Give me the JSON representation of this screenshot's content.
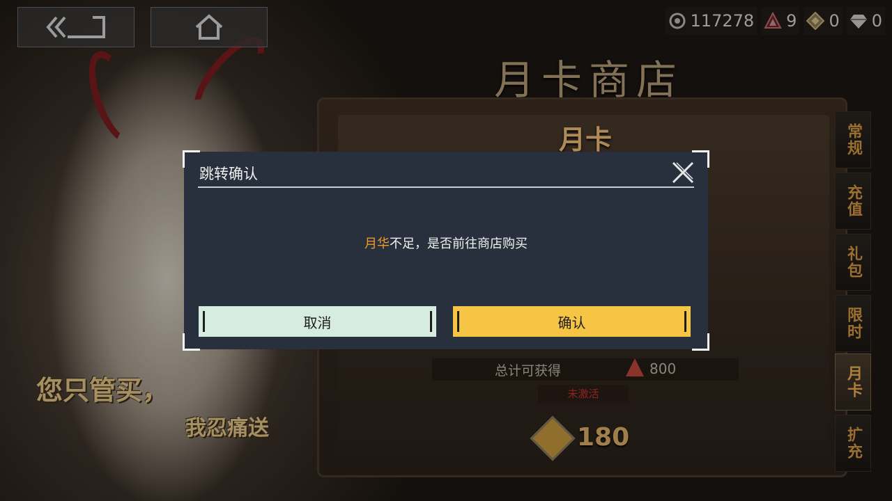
{
  "shop": {
    "title": "月卡商店",
    "card_title": "月卡",
    "total_label": "总计可获得",
    "total_value": "800",
    "status": "未激活",
    "price": "180"
  },
  "tabs": [
    "常规",
    "充值",
    "礼包",
    "限时",
    "月卡",
    "扩充"
  ],
  "active_tab": "月卡",
  "currencies": [
    {
      "icon": "eye-coin-icon",
      "value": "117278"
    },
    {
      "icon": "triangle-gem-icon",
      "value": "9"
    },
    {
      "icon": "diamond-token-icon",
      "value": "0"
    },
    {
      "icon": "crystal-icon",
      "value": "0"
    }
  ],
  "banner": {
    "line1": "您只管买，",
    "line2": "我忍痛送"
  },
  "dialog": {
    "title": "跳转确认",
    "message_highlight": "月华",
    "message_rest": "不足，是否前往商店购买",
    "cancel_label": "取消",
    "confirm_label": "确认"
  },
  "colors": {
    "highlight": "#f19a2c",
    "confirm_button": "#f6c543",
    "cancel_button": "#d6ece0",
    "dialog_bg": "#27303c"
  }
}
